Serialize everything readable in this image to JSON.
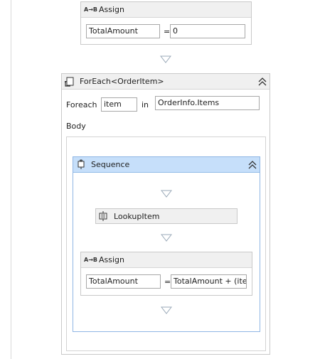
{
  "assign_top": {
    "title": "Assign",
    "icon_label": "A→B",
    "to": "TotalAmount",
    "eq": "=",
    "value": "0"
  },
  "foreach": {
    "title": "ForEach<OrderItem>",
    "foreach_label": "Foreach",
    "item_value": "item",
    "in_label": "in",
    "collection_value": "OrderInfo.Items",
    "body_label": "Body"
  },
  "sequence": {
    "title": "Sequence",
    "lookup_title": "LookupItem",
    "assign": {
      "title": "Assign",
      "icon_label": "A→B",
      "to": "TotalAmount",
      "eq": "=",
      "value": "TotalAmount + (ite"
    }
  },
  "colors": {
    "sequence_header": "#c6dffa",
    "sequence_border": "#8fb6e4",
    "card_header": "#f0f0f0"
  },
  "icons": [
    "assign-icon",
    "foreach-icon",
    "collapse-icon",
    "sequence-icon",
    "lookup-icon",
    "drop-arrow-icon"
  ]
}
